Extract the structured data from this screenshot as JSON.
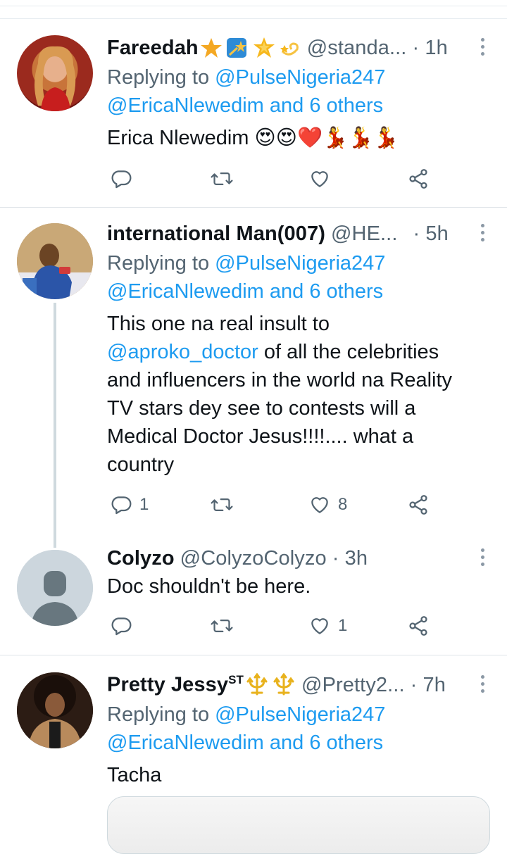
{
  "tweets": [
    {
      "name": "Fareedah",
      "name_emojis": [
        "star",
        "shooting-star-box",
        "glowing-star",
        "dizzy"
      ],
      "handle": "@standa...",
      "time": "· 1h",
      "reply_prefix": "Replying to",
      "reply_to_1": "@PulseNigeria247",
      "reply_to_2": "@EricaNlewedim and 6 others",
      "text": "Erica Nlewedim 😍😍❤️💃💃💃",
      "replies": "",
      "likes": ""
    },
    {
      "name": "international Man(007)",
      "handle": "@HE...",
      "time": "· 5h",
      "reply_prefix": "Replying to",
      "reply_to_1": "@PulseNigeria247",
      "reply_to_2": "@EricaNlewedim and 6 others",
      "text_line1": "This one na real insult to",
      "mention": "@aproko_doctor",
      "text_rest": " of all the celebrities",
      "text_line3": "and influencers in the world na Reality",
      "text_line4": "TV stars dey see to contests will a",
      "text_line5": "Medical Doctor Jesus!!!!.... what a",
      "text_line6": "country",
      "replies": "1",
      "likes": "8"
    },
    {
      "name": "Colyzo",
      "handle": "@ColyzoColyzo",
      "time": "· 3h",
      "text": "Doc shouldn't be here.",
      "replies": "",
      "likes": "1"
    },
    {
      "name": "Pretty Jessy",
      "name_sup": "ST",
      "name_emojis": [
        "trident",
        "trident"
      ],
      "handle": "@Pretty2...",
      "time": "· 7h",
      "reply_prefix": "Replying to",
      "reply_to_1": "@PulseNigeria247",
      "reply_to_2": "@EricaNlewedim and 6 others",
      "text": "Tacha"
    }
  ],
  "colors": {
    "link": "#1d9bf0",
    "secondary_text": "#536471",
    "primary_text": "#0f1419",
    "divider": "#dfe4e8"
  },
  "icons": [
    "reply-icon",
    "retweet-icon",
    "like-icon",
    "share-icon",
    "more-icon"
  ]
}
